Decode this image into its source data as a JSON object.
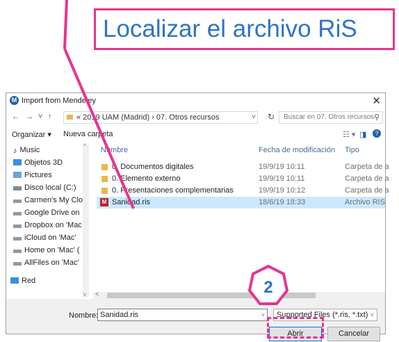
{
  "callout": {
    "text": "Localizar el archivo RiS"
  },
  "step": {
    "number": "2"
  },
  "dialog": {
    "title": "Import from Mendeley",
    "nav": {
      "back": "←",
      "forward": "→",
      "dropdown": "˅",
      "up": "↑"
    },
    "address": "«  2019 UAM (Madrid)  ›  07. Otros recursos",
    "address_dropdown": "˅",
    "refresh": "↻",
    "search_placeholder": "Buscar en 07. Otros recursos",
    "search_icon": "⚲",
    "toolbar": {
      "organize": "Organizar ▾",
      "new_folder": "Nueva carpeta",
      "view": "☷ ▾",
      "pane": "◨",
      "help": "?"
    },
    "sidebar": [
      {
        "label": "Music",
        "icon": "music-icon"
      },
      {
        "label": "Objetos 3D",
        "icon": "cube-icon"
      },
      {
        "label": "Pictures",
        "icon": "pictures-icon"
      },
      {
        "label": "Disco local (C:)",
        "icon": "drive-icon"
      },
      {
        "label": "Carmen's My Clo",
        "icon": "network-drive-icon"
      },
      {
        "label": "Google Drive on",
        "icon": "network-drive-icon"
      },
      {
        "label": "Dropbox on 'Mac",
        "icon": "network-drive-icon"
      },
      {
        "label": "iCloud on 'Mac'",
        "icon": "network-drive-icon"
      },
      {
        "label": "Home on 'Mac' (",
        "icon": "network-drive-icon"
      },
      {
        "label": "AllFiles on 'Mac'",
        "icon": "network-drive-icon"
      },
      {
        "label": "Red",
        "icon": "network-icon"
      }
    ],
    "columns": {
      "name": "Nombre",
      "date": "Fecha de modificación",
      "type": "Tipo"
    },
    "files": [
      {
        "name": "0. Documentos digitales",
        "date": "19/9/19 10:11",
        "type": "Carpeta de a"
      },
      {
        "name": "0. Elemento externo",
        "date": "19/9/19 10:11",
        "type": "Carpeta de a"
      },
      {
        "name": "0. Presentaciones complementarias",
        "date": "19/9/19 10:12",
        "type": "Carpeta de a"
      },
      {
        "name": "Sanidad.ris",
        "date": "18/6/19 18:33",
        "type": "Archivo RIS"
      }
    ],
    "filename_label": "Nombre:",
    "filename_value": "Sanidad.ris",
    "filetype_value": "Supported Files (*.ris, *.txt)",
    "open_button": "Abrir",
    "cancel_button": "Cancelar",
    "close": "✕"
  },
  "colors": {
    "accent": "#e8338f",
    "title_blue": "#2e74c4",
    "selected_row": "#cce8ff"
  }
}
